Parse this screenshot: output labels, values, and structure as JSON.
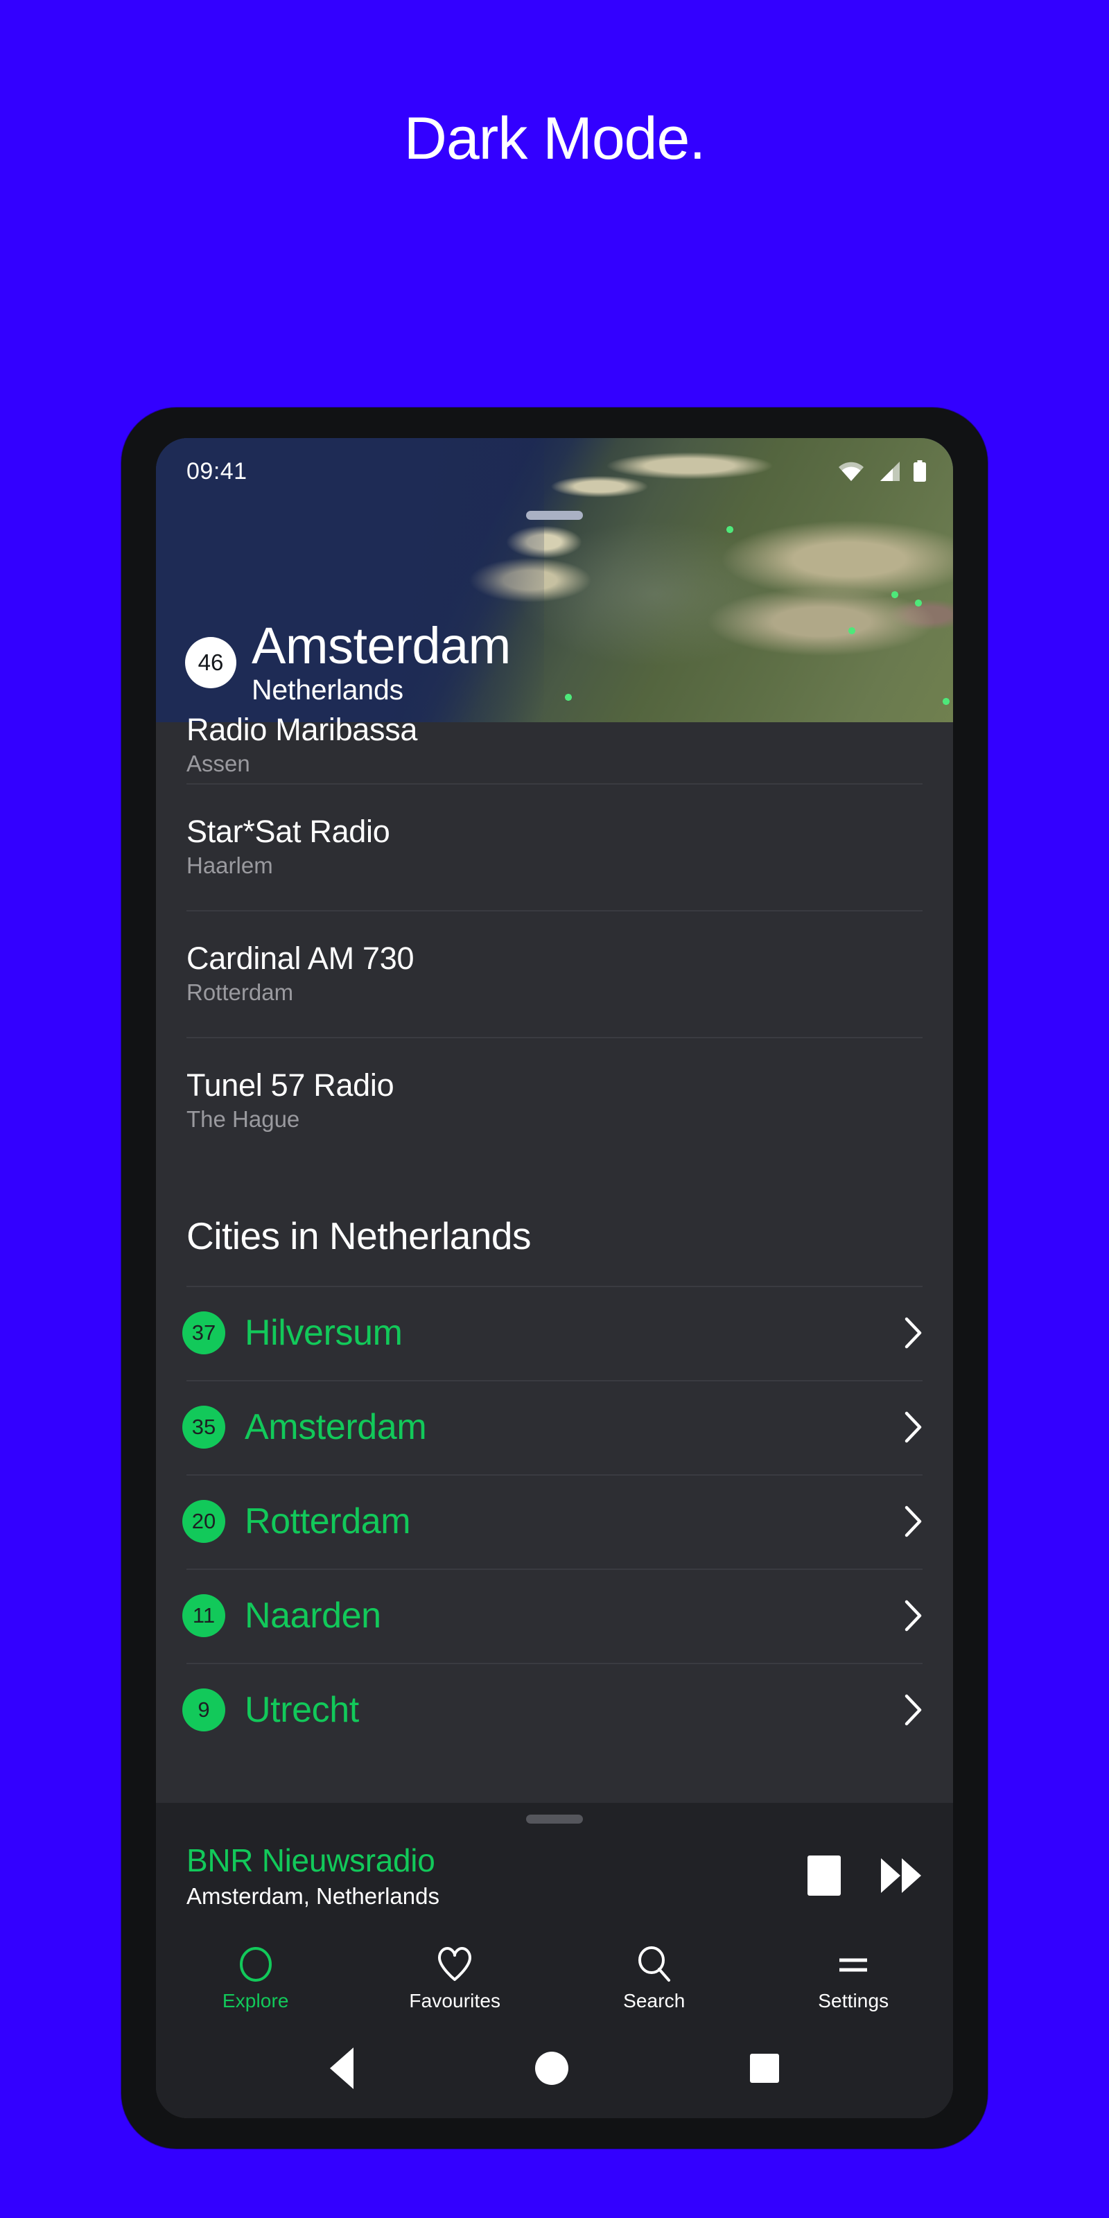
{
  "marketing": {
    "headline": "Dark Mode.",
    "background_color": "#3300FF",
    "headline_color": "#FFFFFF"
  },
  "theme": {
    "accent_green": "#12C95A",
    "surface": "#2D2E33",
    "surface_elevated": "#212226",
    "text_primary": "#FFFFFF",
    "text_secondary": "#9A9A9F",
    "divider": "#3A3B41"
  },
  "status_bar": {
    "time": "09:41",
    "icons": [
      "wifi-icon",
      "cellular-signal-icon",
      "battery-icon"
    ]
  },
  "hero": {
    "badge_count": "46",
    "city": "Amsterdam",
    "country": "Netherlands",
    "map_type": "satellite",
    "drag_handle": "sheet-drag-handle"
  },
  "stations": [
    {
      "name": "Radio Maribassa",
      "city": "Assen",
      "clipped": true
    },
    {
      "name": "Star*Sat Radio",
      "city": "Haarlem",
      "clipped": false
    },
    {
      "name": "Cardinal AM 730",
      "city": "Rotterdam",
      "clipped": false
    },
    {
      "name": "Tunel 57 Radio",
      "city": "The Hague",
      "clipped": false
    }
  ],
  "cities_section": {
    "heading": "Cities in Netherlands",
    "items": [
      {
        "count": "37",
        "name": "Hilversum"
      },
      {
        "count": "35",
        "name": "Amsterdam"
      },
      {
        "count": "20",
        "name": "Rotterdam"
      },
      {
        "count": "11",
        "name": "Naarden"
      },
      {
        "count": "9",
        "name": "Utrecht"
      }
    ]
  },
  "player": {
    "station": "BNR Nieuwsradio",
    "location": "Amsterdam, Netherlands",
    "stop_label": "stop-icon",
    "next_label": "fast-forward-icon"
  },
  "tabs": [
    {
      "label": "Explore",
      "icon": "circle-icon",
      "active": true
    },
    {
      "label": "Favourites",
      "icon": "heart-icon",
      "active": false
    },
    {
      "label": "Search",
      "icon": "magnifier-icon",
      "active": false
    },
    {
      "label": "Settings",
      "icon": "menu-icon",
      "active": false
    }
  ],
  "android_nav": {
    "back": "back-triangle-icon",
    "home": "home-circle-icon",
    "recents": "recents-square-icon"
  }
}
